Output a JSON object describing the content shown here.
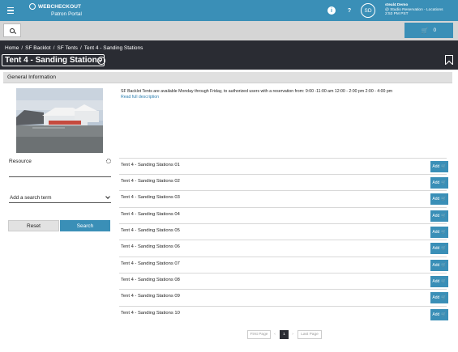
{
  "app": {
    "brand_name": "WEBCHECKOUT",
    "brand_subtitle": "Patron Portal",
    "user_name": "steal4 Demo",
    "user_location": "@ Studio Reservation - Locations",
    "user_time": "2:53 PM PST",
    "avatar_initials": "SD",
    "info_glyph": "i",
    "help_glyph": "?"
  },
  "cart": {
    "count": "0",
    "icon": "cart-icon"
  },
  "breadcrumb": [
    "Home",
    "SF Backlot",
    "SF Tents",
    "Tent 4 - Sanding Stations"
  ],
  "breadcrumb_separator": "/",
  "page": {
    "title": "Tent 4 - Sanding Stations"
  },
  "panel": {
    "heading": "General Information",
    "description": "SF Backlot Tents are available Monday through Friday, to authorized users with a reservation from: 9:00 -11:00 am 12:00 - 2:00 pm 2:00 - 4:00 pm",
    "read_more": "Read full description"
  },
  "filters": {
    "resource_label": "Resource",
    "search_term_placeholder": "Add a search term",
    "reset_label": "Reset",
    "search_label": "Search"
  },
  "resources": [
    "Tent 4 - Sanding Stations 01",
    "Tent 4 - Sanding Stations 02",
    "Tent 4 - Sanding Stations 03",
    "Tent 4 - Sanding Stations 04",
    "Tent 4 - Sanding Stations 05",
    "Tent 4 - Sanding Stations 06",
    "Tent 4 - Sanding Stations 07",
    "Tent 4 - Sanding Stations 08",
    "Tent 4 - Sanding Stations 09",
    "Tent 4 - Sanding Stations 10"
  ],
  "add_label": "Add",
  "pagination": {
    "first": "First Page",
    "prev": "‹",
    "current": "1",
    "next": "›",
    "last": "Last Page"
  },
  "colors": {
    "accent": "#3a8fb7",
    "dark_band": "#2a2c33",
    "toolbar": "#d5d5d5"
  }
}
